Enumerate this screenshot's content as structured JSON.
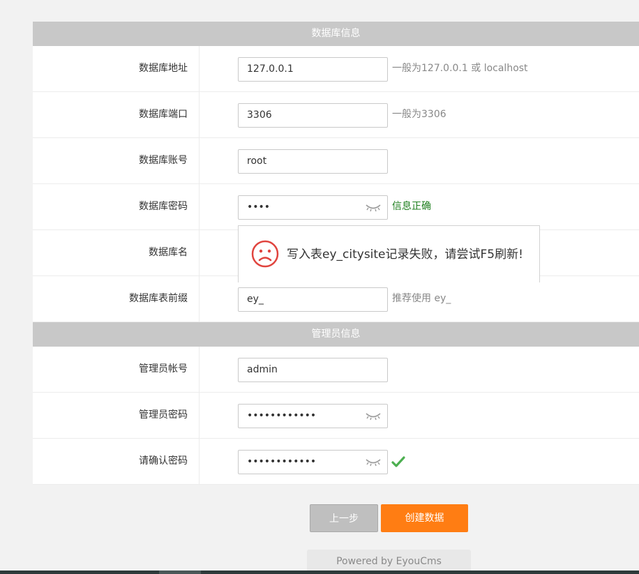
{
  "db_section": {
    "title": "数据库信息",
    "rows": [
      {
        "label": "数据库地址",
        "value": "127.0.0.1",
        "hint": "一般为127.0.0.1 或 localhost"
      },
      {
        "label": "数据库端口",
        "value": "3306",
        "hint": "一般为3306"
      },
      {
        "label": "数据库账号",
        "value": "root",
        "hint": ""
      },
      {
        "label": "数据库密码",
        "value": "••••",
        "hint": "信息正确",
        "icon": "eye-closed-icon"
      },
      {
        "label": "数据库名",
        "value": "",
        "hint": ""
      },
      {
        "label": "数据库表前缀",
        "value": "ey_",
        "hint": "推荐使用 ey_"
      }
    ]
  },
  "admin_section": {
    "title": "管理员信息",
    "rows": [
      {
        "label": "管理员帐号",
        "value": "admin"
      },
      {
        "label": "管理员密码",
        "value": "••••••••••••",
        "icon": "eye-closed-icon"
      },
      {
        "label": "请确认密码",
        "value": "••••••••••••",
        "icon": "eye-closed-icon",
        "status_icon": "checkmark-icon"
      }
    ]
  },
  "toast": {
    "icon": "sad-face-icon",
    "message": "写入表ey_citysite记录失败，请尝试F5刷新!"
  },
  "buttons": {
    "prev": "上一步",
    "create": "创建数据"
  },
  "footer": "Powered by EyouCms",
  "colors": {
    "accent": "#ff7d13",
    "success": "#1e7f1e",
    "header_bg": "#c8c8c8",
    "error_face": "#e0443e"
  }
}
